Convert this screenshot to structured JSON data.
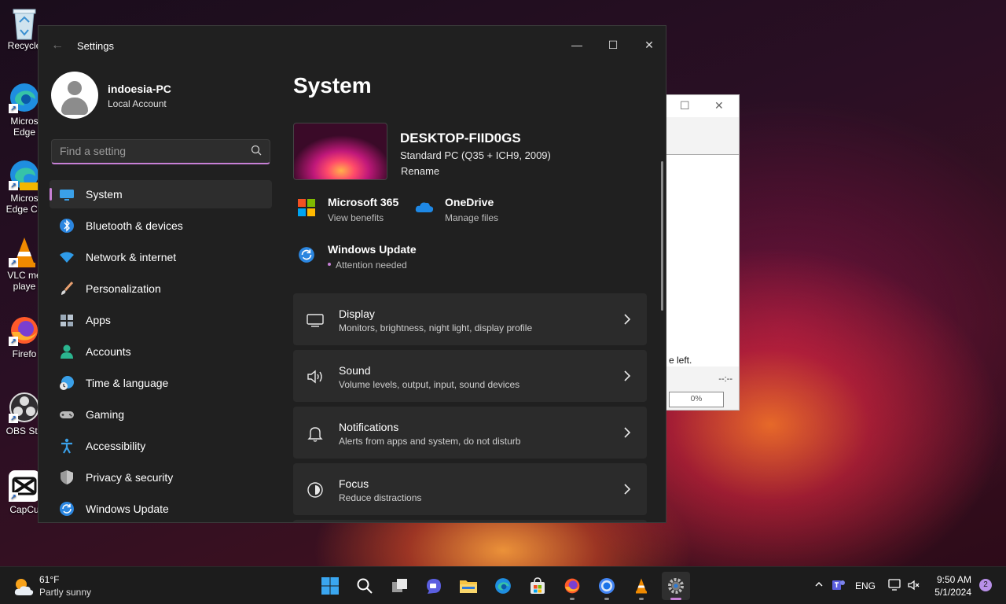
{
  "desktop": {
    "icons": [
      {
        "label": "Recycle"
      },
      {
        "label": "Micros Edge"
      },
      {
        "label": "Micros Edge Ca"
      },
      {
        "label": "VLC me playe"
      },
      {
        "label": "Firefo"
      },
      {
        "label": "OBS Stu"
      },
      {
        "label": "CapCu"
      }
    ]
  },
  "background_window": {
    "status_text": "e left.",
    "time_text": "--:--",
    "progress_text": "0%"
  },
  "settings": {
    "window_title": "Settings",
    "user": {
      "name": "indoesia-PC",
      "account_type": "Local Account"
    },
    "search": {
      "placeholder": "Find a setting"
    },
    "nav": [
      {
        "label": "System",
        "icon": "system-icon",
        "active": true
      },
      {
        "label": "Bluetooth & devices",
        "icon": "bluetooth-icon"
      },
      {
        "label": "Network & internet",
        "icon": "wifi-icon"
      },
      {
        "label": "Personalization",
        "icon": "brush-icon"
      },
      {
        "label": "Apps",
        "icon": "apps-icon"
      },
      {
        "label": "Accounts",
        "icon": "person-icon"
      },
      {
        "label": "Time & language",
        "icon": "clock-globe-icon"
      },
      {
        "label": "Gaming",
        "icon": "gamepad-icon"
      },
      {
        "label": "Accessibility",
        "icon": "accessibility-icon"
      },
      {
        "label": "Privacy & security",
        "icon": "shield-icon"
      },
      {
        "label": "Windows Update",
        "icon": "update-icon"
      }
    ],
    "page_title": "System",
    "device": {
      "name": "DESKTOP-FIID0GS",
      "model": "Standard PC (Q35 + ICH9, 2009)",
      "rename_label": "Rename"
    },
    "quick_links": [
      {
        "title": "Microsoft 365",
        "subtitle": "View benefits",
        "icon": "microsoft-logo-icon"
      },
      {
        "title": "OneDrive",
        "subtitle": "Manage files",
        "icon": "onedrive-cloud-icon"
      },
      {
        "title": "Windows Update",
        "subtitle": "Attention needed",
        "icon": "update-icon"
      }
    ],
    "cards": [
      {
        "title": "Display",
        "subtitle": "Monitors, brightness, night light, display profile",
        "icon": "monitor-icon"
      },
      {
        "title": "Sound",
        "subtitle": "Volume levels, output, input, sound devices",
        "icon": "speaker-icon"
      },
      {
        "title": "Notifications",
        "subtitle": "Alerts from apps and system, do not disturb",
        "icon": "bell-icon"
      },
      {
        "title": "Focus",
        "subtitle": "Reduce distractions",
        "icon": "focus-icon"
      }
    ]
  },
  "taskbar": {
    "weather": {
      "temp": "61°F",
      "condition": "Partly sunny"
    },
    "language": "ENG",
    "time": "9:50 AM",
    "date": "5/1/2024",
    "notification_count": "2"
  },
  "colors": {
    "accent": "#c780d6",
    "window_bg": "#202020",
    "card_bg": "#2b2b2b"
  }
}
